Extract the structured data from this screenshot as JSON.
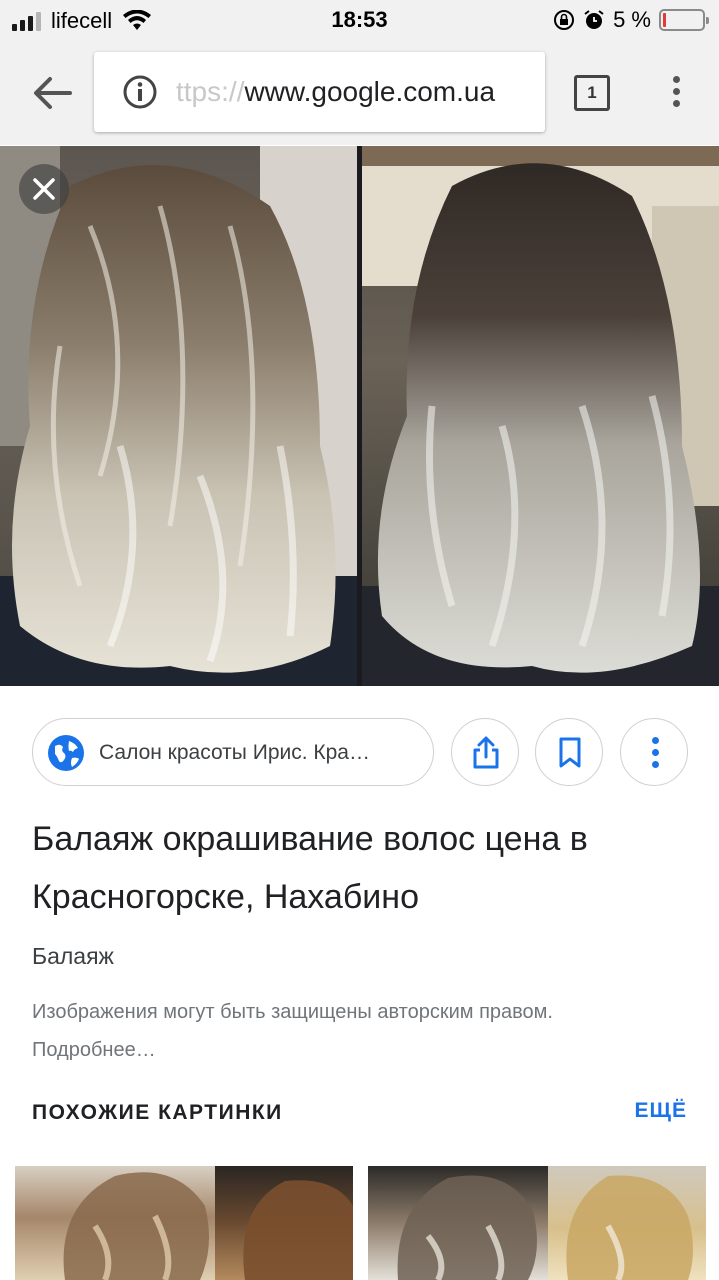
{
  "status_bar": {
    "carrier": "lifecell",
    "time": "18:53",
    "battery_percent": "5 %",
    "battery_level": 0.05
  },
  "toolbar": {
    "url_faded": "ttps://",
    "url_main": "www.google.com.ua",
    "tab_count": "1"
  },
  "image_viewer": {
    "photo_left": "hair-balayage-photo-left",
    "photo_right": "hair-balayage-photo-right"
  },
  "result": {
    "source_name": "Салон красоты Ирис. Кра…",
    "title": "Балаяж окрашивание волос цена в Красногорске, Нахабино",
    "subtitle": "Балаяж",
    "copyright_notice": "Изображения могут быть защищены авторским правом. Подробнее…"
  },
  "similar": {
    "header": "ПОХОЖИЕ КАРТИНКИ",
    "more_label": "ЕЩЁ"
  },
  "colors": {
    "accent": "#1a73e8",
    "battery_low": "#e53935",
    "toolbar_bg": "#f1f1f1"
  }
}
